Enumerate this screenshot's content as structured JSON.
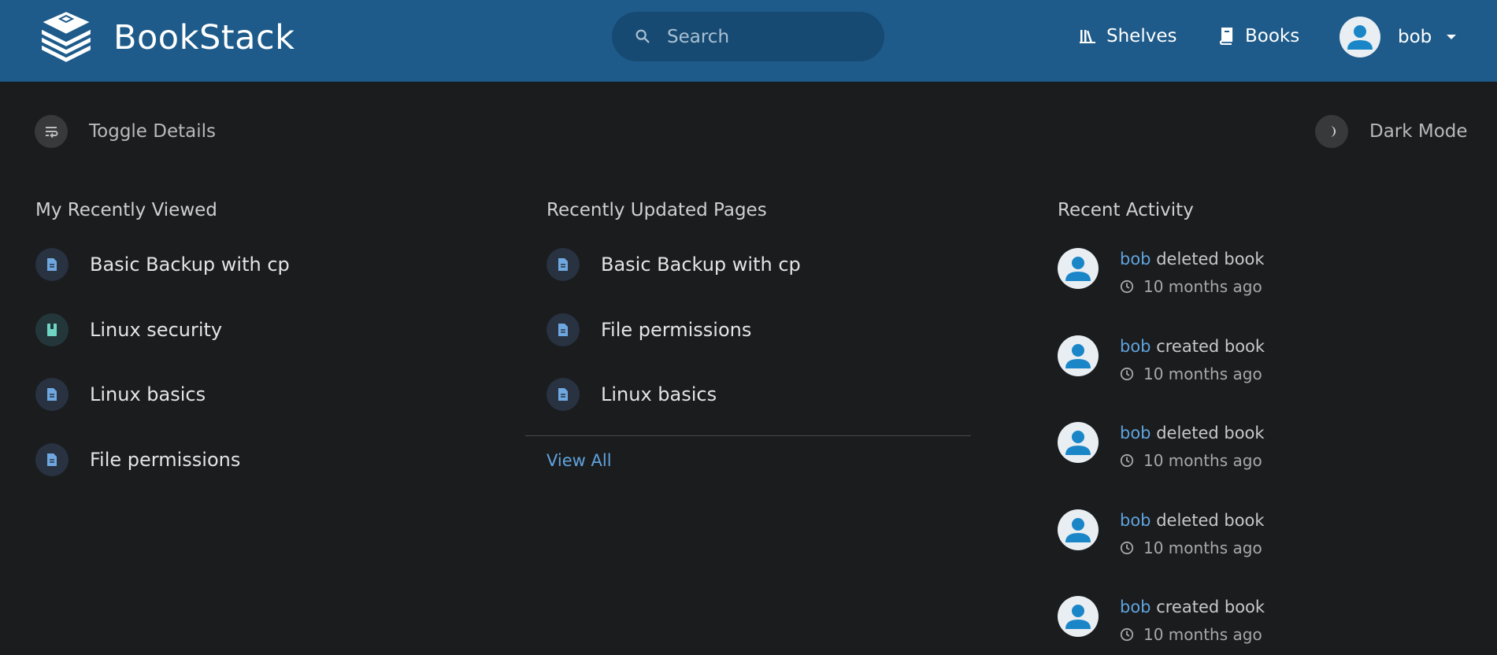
{
  "header": {
    "app_title": "BookStack",
    "search_placeholder": "Search",
    "nav": {
      "shelves": "Shelves",
      "books": "Books"
    },
    "user": "bob",
    "colors": {
      "bar": "#1e5b8a",
      "search_bg": "#174a72"
    }
  },
  "actions": {
    "toggle_details": "Toggle Details",
    "dark_mode": "Dark Mode"
  },
  "recently_viewed": {
    "title": "My Recently Viewed",
    "items": [
      {
        "label": "Basic Backup with cp",
        "icon": "page-icon"
      },
      {
        "label": "Linux security",
        "icon": "book-icon"
      },
      {
        "label": "Linux basics",
        "icon": "page-icon"
      },
      {
        "label": "File permissions",
        "icon": "page-icon"
      }
    ]
  },
  "recently_updated": {
    "title": "Recently Updated Pages",
    "items": [
      {
        "label": "Basic Backup with cp",
        "icon": "page-icon"
      },
      {
        "label": "File permissions",
        "icon": "page-icon"
      },
      {
        "label": "Linux basics",
        "icon": "page-icon"
      }
    ],
    "view_all": "View All"
  },
  "recent_activity": {
    "title": "Recent Activity",
    "items": [
      {
        "user": "bob",
        "action": "deleted book",
        "time": "10 months ago"
      },
      {
        "user": "bob",
        "action": "created book",
        "time": "10 months ago"
      },
      {
        "user": "bob",
        "action": "deleted book",
        "time": "10 months ago"
      },
      {
        "user": "bob",
        "action": "deleted book",
        "time": "10 months ago"
      },
      {
        "user": "bob",
        "action": "created book",
        "time": "10 months ago"
      }
    ]
  },
  "colors": {
    "background": "#1b1c1e",
    "link": "#5fa3dd",
    "page_icon": "#6fa8e0",
    "book_icon": "#6fd6c6"
  }
}
